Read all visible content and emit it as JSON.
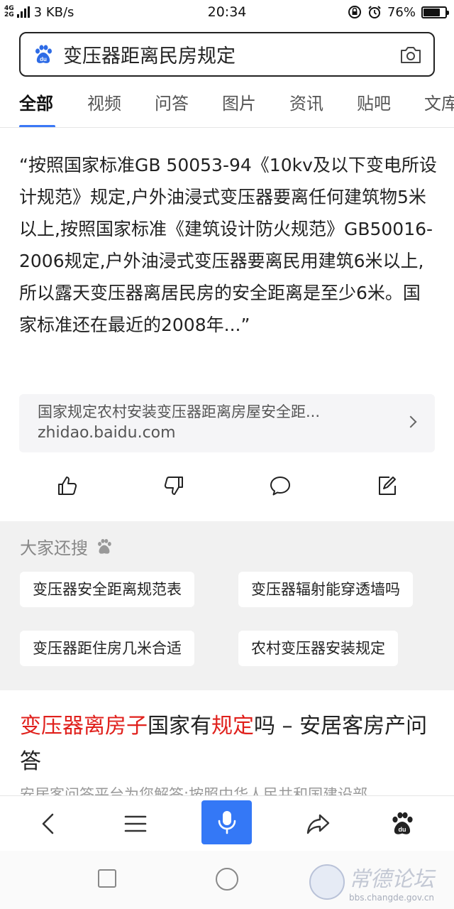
{
  "status_bar": {
    "network_top": "4G",
    "network_bottom": "2G",
    "speed": "3 KB/s",
    "time": "20:34",
    "battery": "76%",
    "battery_level": 0.76
  },
  "search": {
    "query": "变压器距离民房规定"
  },
  "tabs": [
    {
      "label": "全部",
      "active": true
    },
    {
      "label": "视频"
    },
    {
      "label": "问答"
    },
    {
      "label": "图片"
    },
    {
      "label": "资讯"
    },
    {
      "label": "贴吧"
    },
    {
      "label": "文库"
    }
  ],
  "answer": {
    "text": "“按照国家标准GB 50053-94《10kv及以下变电所设计规范》规定,户外油浸式变压器要离任何建筑物5米以上,按照国家标准《建筑设计防火规范》GB50016-2006规定,户外油浸式变压器要离民用建筑6米以上,所以露天变压器离居民房的安全距离是至少6米。国家标准还在最近的2008年...”",
    "source_title": "国家规定农村安装变压器距离房屋安全距...",
    "source_domain": "zhidao.baidu.com"
  },
  "related": {
    "title": "大家还搜",
    "items": [
      "变压器安全距离规范表",
      "变压器辐射能穿透墙吗",
      "变压器距住房几米合适",
      "农村变压器安装规定"
    ]
  },
  "result": {
    "title_parts": [
      {
        "text": "变压器离房子",
        "highlight": true
      },
      {
        "text": "国家有",
        "highlight": false
      },
      {
        "text": "规定",
        "highlight": true
      },
      {
        "text": "吗 – 安居客房产问答",
        "highlight": false
      }
    ],
    "snippet": "安居客问答平台为您解答:按照中华人民共和国建设部"
  },
  "watermark": {
    "brand": "常德论坛",
    "url": "bbs.changde.gov.cn"
  },
  "colors": {
    "accent": "#3478f6",
    "highlight": "#e0201c"
  }
}
